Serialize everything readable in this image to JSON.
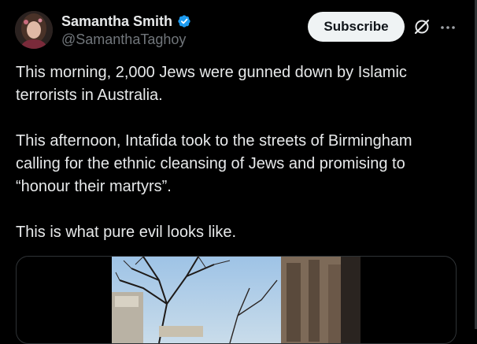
{
  "author": {
    "display_name": "Samantha Smith",
    "handle": "@SamanthaTaghoy",
    "verified": true
  },
  "actions": {
    "subscribe_label": "Subscribe",
    "grok_icon": "grok-slash-circle-icon",
    "more_icon": "more-horizontal-icon"
  },
  "tweet": {
    "paragraphs": [
      "This morning, 2,000 Jews were gunned down by Islamic terrorists in Australia.",
      "This afternoon, Intafida took to the streets of Birmingham calling for the ethnic cleansing of Jews and promising to “honour their martyrs”.",
      "This is what pure evil looks like."
    ]
  },
  "media": {
    "type": "video-still",
    "description_icon": "video-thumbnail"
  },
  "colors": {
    "background": "#000000",
    "text_primary": "#e7e9ea",
    "text_secondary": "#71767b",
    "verified_blue": "#1d9bf0",
    "subscribe_bg": "#eff3f4",
    "border": "#2f3336"
  }
}
